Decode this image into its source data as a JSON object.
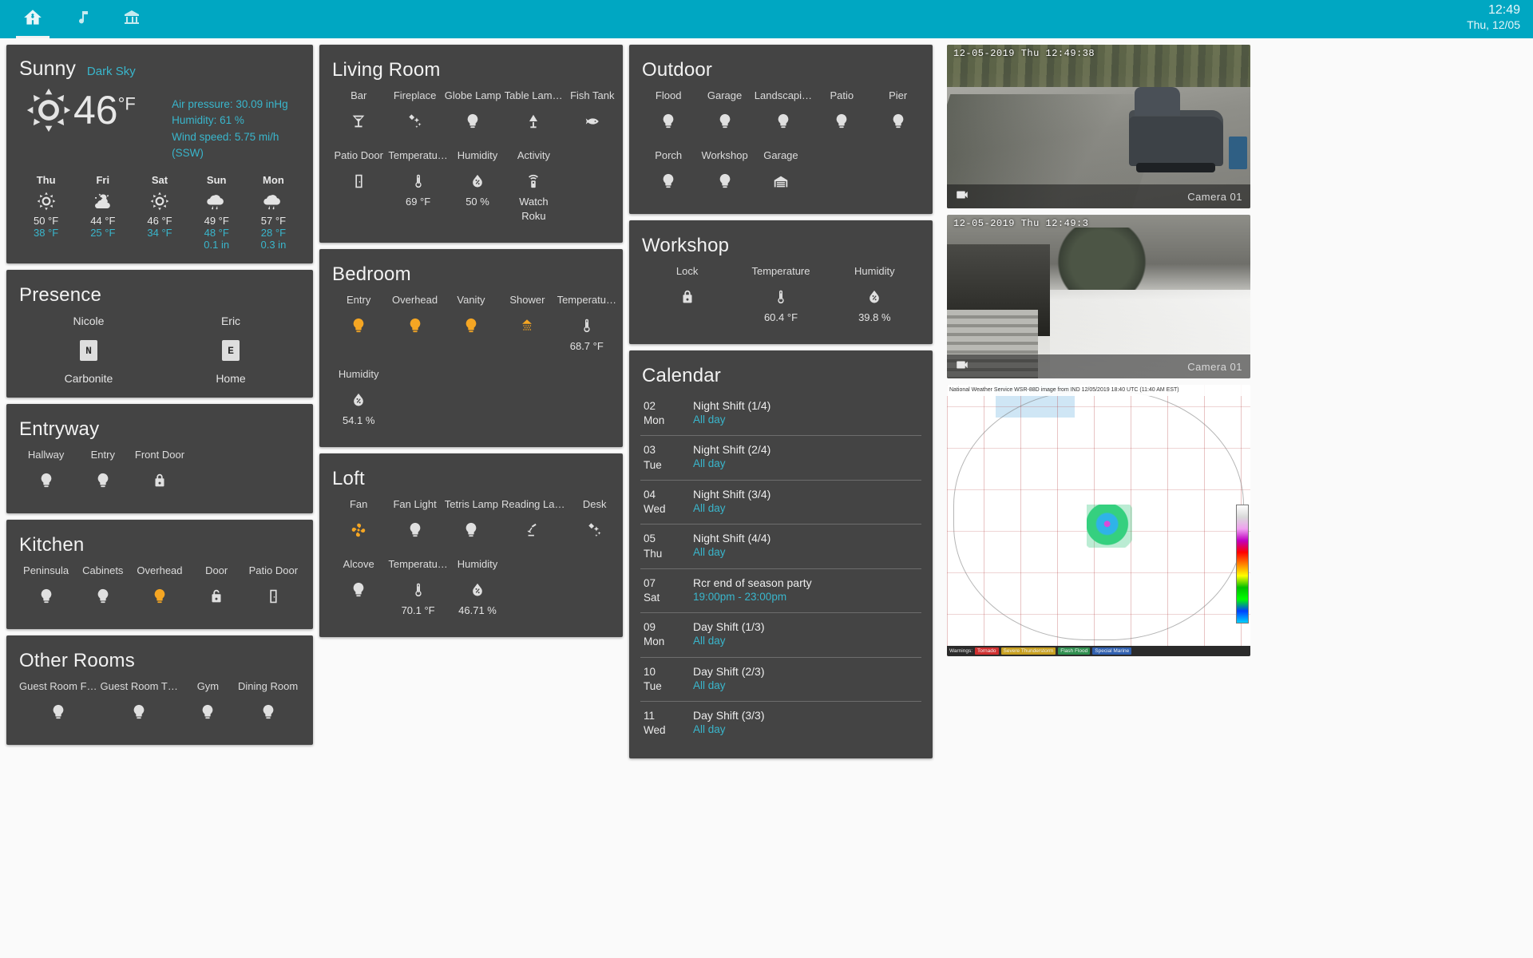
{
  "topbar": {
    "tabs": [
      {
        "icon": "home-assistant-icon",
        "name": "tab-home"
      },
      {
        "icon": "music-note-icon",
        "name": "tab-music"
      },
      {
        "icon": "bank-icon",
        "name": "tab-house"
      }
    ],
    "time": "12:49",
    "date": "Thu, 12/05"
  },
  "weather": {
    "condition": "Sunny",
    "source": "Dark Sky",
    "temperature": "46",
    "unit": "°F",
    "icon": "sunny-icon",
    "attributes": [
      "Air pressure: 30.09 inHg",
      "Humidity: 61 %",
      "Wind speed: 5.75 mi/h (SSW)"
    ],
    "forecast": [
      {
        "day": "Thu",
        "icon": "sunny-icon",
        "high": "50 °F",
        "low": "38 °F",
        "precip": ""
      },
      {
        "day": "Fri",
        "icon": "partly-cloudy-icon",
        "high": "44 °F",
        "low": "25 °F",
        "precip": ""
      },
      {
        "day": "Sat",
        "icon": "sunny-icon",
        "high": "46 °F",
        "low": "34 °F",
        "precip": ""
      },
      {
        "day": "Sun",
        "icon": "rainy-icon",
        "high": "49 °F",
        "low": "48 °F",
        "precip": "0.1 in"
      },
      {
        "day": "Mon",
        "icon": "rainy-icon",
        "high": "57 °F",
        "low": "28 °F",
        "precip": "0.3 in"
      }
    ]
  },
  "presence": {
    "title": "Presence",
    "people": [
      {
        "name": "Nicole",
        "initial": "N",
        "state": "Carbonite"
      },
      {
        "name": "Eric",
        "initial": "E",
        "state": "Home"
      }
    ]
  },
  "entryway": {
    "title": "Entryway",
    "items": [
      {
        "label": "Hallway",
        "icon": "lightbulb-icon",
        "on": false,
        "value": ""
      },
      {
        "label": "Entry",
        "icon": "lightbulb-icon",
        "on": false,
        "value": ""
      },
      {
        "label": "Front Door",
        "icon": "lock-closed-icon",
        "on": false,
        "value": ""
      }
    ]
  },
  "kitchen": {
    "title": "Kitchen",
    "items": [
      {
        "label": "Peninsula",
        "icon": "lightbulb-icon",
        "on": false,
        "value": ""
      },
      {
        "label": "Cabinets",
        "icon": "lightbulb-icon",
        "on": false,
        "value": ""
      },
      {
        "label": "Overhead",
        "icon": "lightbulb-icon",
        "on": true,
        "value": ""
      },
      {
        "label": "Door",
        "icon": "lock-open-icon",
        "on": false,
        "value": ""
      },
      {
        "label": "Patio Door",
        "icon": "door-icon",
        "on": false,
        "value": ""
      }
    ]
  },
  "other_rooms": {
    "title": "Other Rooms",
    "items": [
      {
        "label": "Guest Room F…",
        "icon": "lightbulb-icon",
        "on": false,
        "value": ""
      },
      {
        "label": "Guest Room T…",
        "icon": "lightbulb-icon",
        "on": false,
        "value": ""
      },
      {
        "label": "Gym",
        "icon": "lightbulb-icon",
        "on": false,
        "value": ""
      },
      {
        "label": "Dining Room",
        "icon": "lightbulb-icon",
        "on": false,
        "value": ""
      }
    ]
  },
  "living_room": {
    "title": "Living Room",
    "row1": [
      {
        "label": "Bar",
        "icon": "martini-icon",
        "on": false,
        "value": ""
      },
      {
        "label": "Fireplace",
        "icon": "fire-icon",
        "on": false,
        "value": ""
      },
      {
        "label": "Globe Lamp",
        "icon": "lightbulb-icon",
        "on": false,
        "value": ""
      },
      {
        "label": "Table Lam…",
        "icon": "lamp-icon",
        "on": false,
        "value": ""
      },
      {
        "label": "Fish Tank",
        "icon": "fish-icon",
        "on": false,
        "value": ""
      }
    ],
    "row2": [
      {
        "label": "Patio Door",
        "icon": "door-icon",
        "on": false,
        "value": ""
      },
      {
        "label": "Temperatu…",
        "icon": "thermometer-icon",
        "on": false,
        "value": "69 °F"
      },
      {
        "label": "Humidity",
        "icon": "water-percent-icon",
        "on": false,
        "value": "50 %"
      },
      {
        "label": "Activity",
        "icon": "remote-icon",
        "on": false,
        "value": "Watch Roku"
      }
    ]
  },
  "bedroom": {
    "title": "Bedroom",
    "row1": [
      {
        "label": "Entry",
        "icon": "lightbulb-icon",
        "on": true,
        "value": ""
      },
      {
        "label": "Overhead",
        "icon": "lightbulb-icon",
        "on": true,
        "value": ""
      },
      {
        "label": "Vanity",
        "icon": "lightbulb-icon",
        "on": true,
        "value": ""
      },
      {
        "label": "Shower",
        "icon": "shower-icon",
        "on": true,
        "value": ""
      },
      {
        "label": "Temperatu…",
        "icon": "thermometer-icon",
        "on": false,
        "value": "68.7 °F"
      }
    ],
    "row2": [
      {
        "label": "Humidity",
        "icon": "water-percent-icon",
        "on": false,
        "value": "54.1 %"
      }
    ]
  },
  "loft": {
    "title": "Loft",
    "row1": [
      {
        "label": "Fan",
        "icon": "fan-icon",
        "on": true,
        "value": ""
      },
      {
        "label": "Fan Light",
        "icon": "lightbulb-icon",
        "on": false,
        "value": ""
      },
      {
        "label": "Tetris Lamp",
        "icon": "lightbulb-icon",
        "on": false,
        "value": ""
      },
      {
        "label": "Reading La…",
        "icon": "desk-lamp-icon",
        "on": false,
        "value": ""
      },
      {
        "label": "Desk",
        "icon": "fire-icon",
        "on": false,
        "value": ""
      }
    ],
    "row2": [
      {
        "label": "Alcove",
        "icon": "lightbulb-icon",
        "on": false,
        "value": ""
      },
      {
        "label": "Temperatu…",
        "icon": "thermometer-icon",
        "on": false,
        "value": "70.1 °F"
      },
      {
        "label": "Humidity",
        "icon": "water-percent-icon",
        "on": false,
        "value": "46.71 %"
      }
    ]
  },
  "outdoor": {
    "title": "Outdoor",
    "row1": [
      {
        "label": "Flood",
        "icon": "lightbulb-icon",
        "on": false,
        "value": ""
      },
      {
        "label": "Garage",
        "icon": "lightbulb-icon",
        "on": false,
        "value": ""
      },
      {
        "label": "Landscapi…",
        "icon": "lightbulb-icon",
        "on": false,
        "value": ""
      },
      {
        "label": "Patio",
        "icon": "lightbulb-icon",
        "on": false,
        "value": ""
      },
      {
        "label": "Pier",
        "icon": "lightbulb-icon",
        "on": false,
        "value": ""
      }
    ],
    "row2": [
      {
        "label": "Porch",
        "icon": "lightbulb-icon",
        "on": false,
        "value": ""
      },
      {
        "label": "Workshop",
        "icon": "lightbulb-icon",
        "on": false,
        "value": ""
      },
      {
        "label": "Garage",
        "icon": "garage-icon",
        "on": false,
        "value": ""
      }
    ]
  },
  "workshop": {
    "title": "Workshop",
    "items": [
      {
        "label": "Lock",
        "icon": "lock-closed-icon",
        "on": false,
        "value": ""
      },
      {
        "label": "Temperature",
        "icon": "thermometer-icon",
        "on": false,
        "value": "60.4 °F"
      },
      {
        "label": "Humidity",
        "icon": "water-percent-icon",
        "on": false,
        "value": "39.8 %"
      }
    ]
  },
  "calendar": {
    "title": "Calendar",
    "events": [
      {
        "day": "02",
        "weekday": "Mon",
        "title": "Night Shift (1/4)",
        "time": "All day"
      },
      {
        "day": "03",
        "weekday": "Tue",
        "title": "Night Shift (2/4)",
        "time": "All day"
      },
      {
        "day": "04",
        "weekday": "Wed",
        "title": "Night Shift (3/4)",
        "time": "All day"
      },
      {
        "day": "05",
        "weekday": "Thu",
        "title": "Night Shift (4/4)",
        "time": "All day"
      },
      {
        "day": "07",
        "weekday": "Sat",
        "title": "Rcr end of season party",
        "time": "19:00pm - 23:00pm"
      },
      {
        "day": "09",
        "weekday": "Mon",
        "title": "Day Shift (1/3)",
        "time": "All day"
      },
      {
        "day": "10",
        "weekday": "Tue",
        "title": "Day Shift (2/3)",
        "time": "All day"
      },
      {
        "day": "11",
        "weekday": "Wed",
        "title": "Day Shift (3/3)",
        "time": "All day"
      }
    ]
  },
  "cameras": [
    {
      "timestamp": "12-05-2019 Thu 12:49:38",
      "name": "Camera 01",
      "icon": "video-icon"
    },
    {
      "timestamp": "12-05-2019 Thu 12:49:3",
      "name": "Camera 01",
      "icon": "video-icon"
    }
  ],
  "radar": {
    "header": "National Weather Service WSR-88D image from IND 12/05/2019 18:40 UTC (11:40 AM EST)",
    "warnings_label": "Warnings:",
    "warnings": [
      "Tornado",
      "Severe Thunderstorm",
      "Flash Flood",
      "Special Marine"
    ]
  }
}
